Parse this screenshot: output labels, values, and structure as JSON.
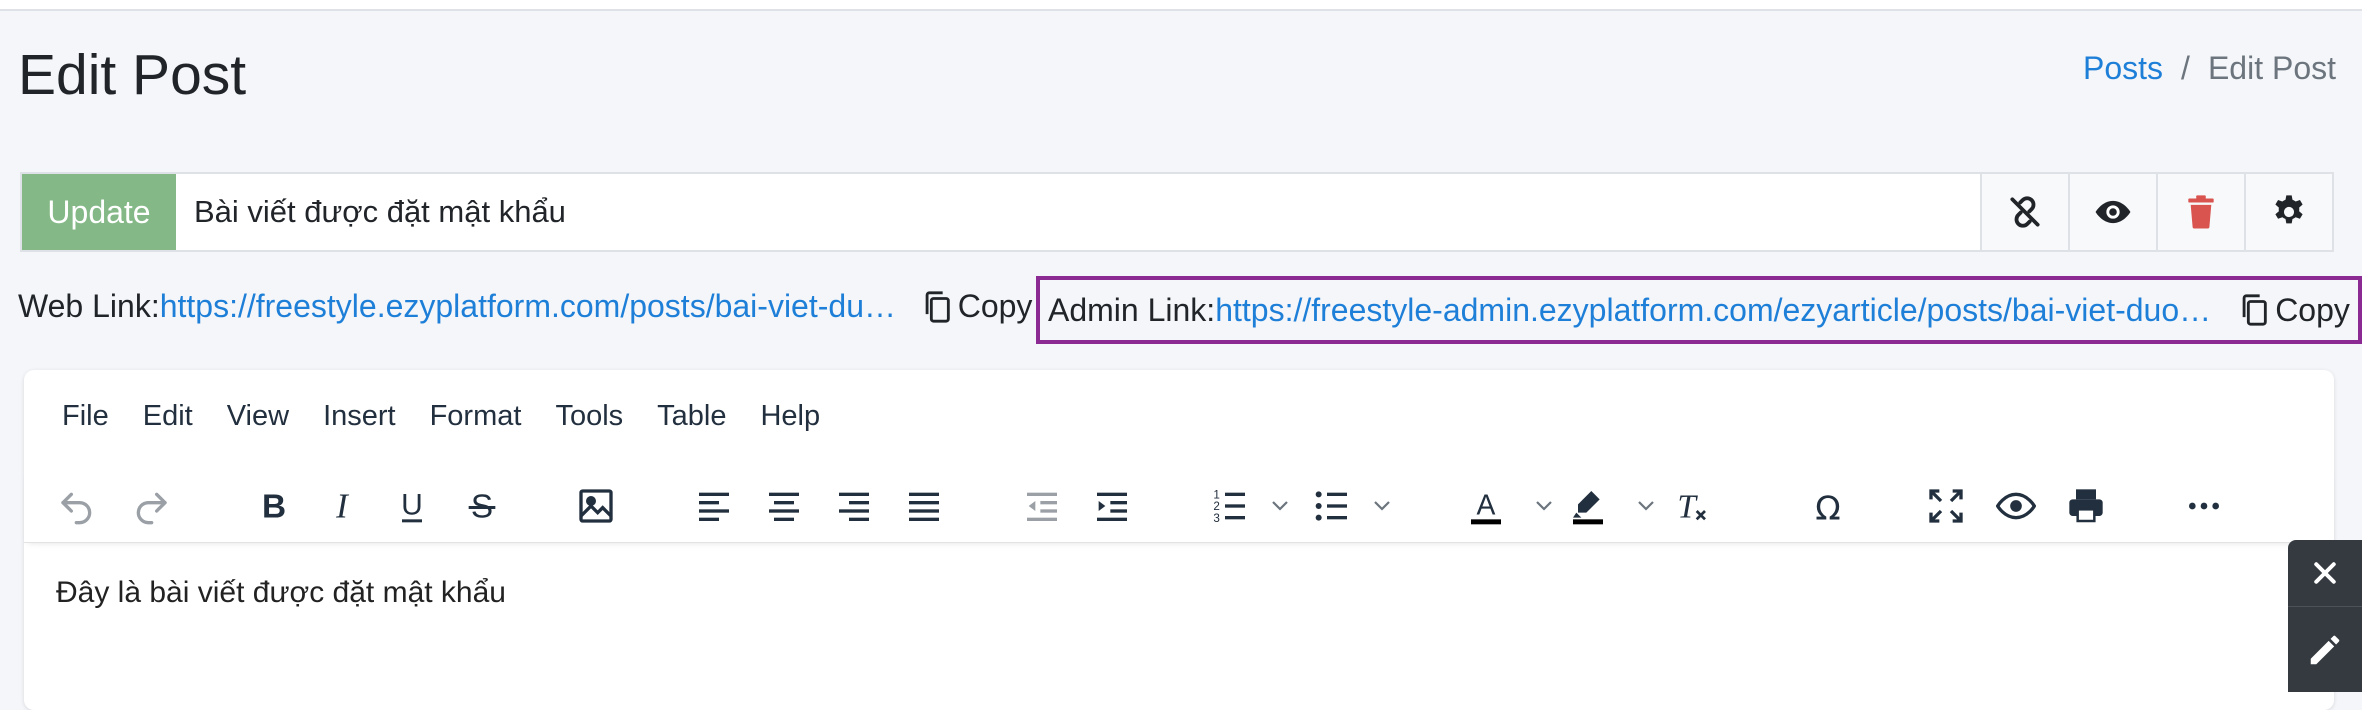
{
  "header": {
    "title": "Edit Post",
    "breadcrumb": {
      "link": "Posts",
      "separator": "/",
      "current": "Edit Post"
    }
  },
  "title_bar": {
    "update_label": "Update",
    "title_value": "Bài viết được đặt mật khẩu",
    "icons": [
      "unlink-icon",
      "eye-icon",
      "trash-icon",
      "gear-icon"
    ]
  },
  "links": {
    "web_label": "Web Link:",
    "web_url": "https://freestyle.ezyplatform.com/posts/bai-viet-duoc-dat-mat-khau",
    "admin_label": "Admin Link:",
    "admin_url": "https://freestyle-admin.ezyplatform.com/ezyarticle/posts/bai-viet-duoc-dat-mat-khau",
    "copy_label": "Copy"
  },
  "editor": {
    "menu": [
      "File",
      "Edit",
      "View",
      "Insert",
      "Format",
      "Tools",
      "Table",
      "Help"
    ],
    "content": "Đây là bài viết được đặt mật khẩu",
    "colors": {
      "text_color": "#000000",
      "highlight": "#000000"
    }
  },
  "colors": {
    "accent": "#1e7fd8",
    "update_button": "#84b886",
    "admin_border": "#8a2a92",
    "delete": "#d9534f"
  }
}
